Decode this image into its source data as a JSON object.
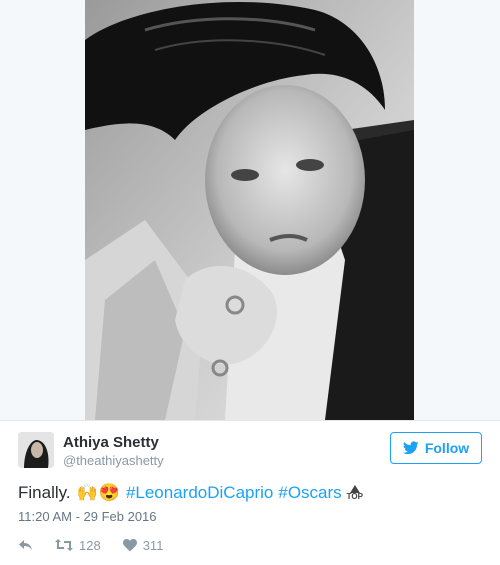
{
  "tweet": {
    "author": {
      "name": "Athiya Shetty",
      "handle": "@theathiyashetty",
      "avatar_icon": "avatar-photo-icon"
    },
    "follow_label": "Follow",
    "text_plain": "Finally.",
    "emojis": [
      "🙌",
      "😍"
    ],
    "hashtags": [
      "#LeonardoDiCaprio",
      "#Oscars"
    ],
    "top_badge": "TOP",
    "timestamp": "11:20 AM - 29 Feb 2016",
    "retweet_count": "128",
    "like_count": "311",
    "colors": {
      "link": "#1da1f2",
      "meta": "#8899a6",
      "text": "#292f33"
    }
  }
}
